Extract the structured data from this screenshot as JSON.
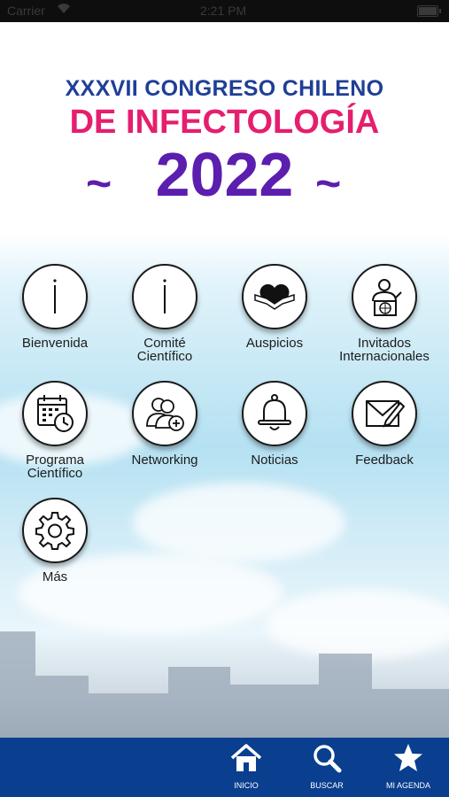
{
  "status": {
    "carrier": "Carrier",
    "time": "2:21 PM"
  },
  "header": {
    "line1": "XXXVII CONGRESO CHILENO",
    "line2": "DE INFECTOLOGÍA",
    "year": "2022"
  },
  "menu": [
    {
      "label": "Bienvenida",
      "icon": "info-icon"
    },
    {
      "label": "Comité\nCientífico",
      "icon": "info-icon"
    },
    {
      "label": "Auspicios",
      "icon": "handshake-heart-icon"
    },
    {
      "label": "Invitados\nInternacionales",
      "icon": "speaker-globe-icon"
    },
    {
      "label": "Programa\nCientífico",
      "icon": "calendar-clock-icon"
    },
    {
      "label": "Networking",
      "icon": "people-add-icon"
    },
    {
      "label": "Noticias",
      "icon": "bell-icon"
    },
    {
      "label": "Feedback",
      "icon": "envelope-pen-icon"
    },
    {
      "label": "Más",
      "icon": "gear-icon"
    }
  ],
  "tabs": [
    {
      "label": "INICIO",
      "icon": "home-icon"
    },
    {
      "label": "BUSCAR",
      "icon": "search-icon"
    },
    {
      "label": "MI AGENDA",
      "icon": "star-icon"
    }
  ],
  "colors": {
    "title_blue": "#1f3f96",
    "title_pink": "#e51e6e",
    "title_purple": "#5b1eae",
    "tabbar": "#0a3e8f"
  }
}
